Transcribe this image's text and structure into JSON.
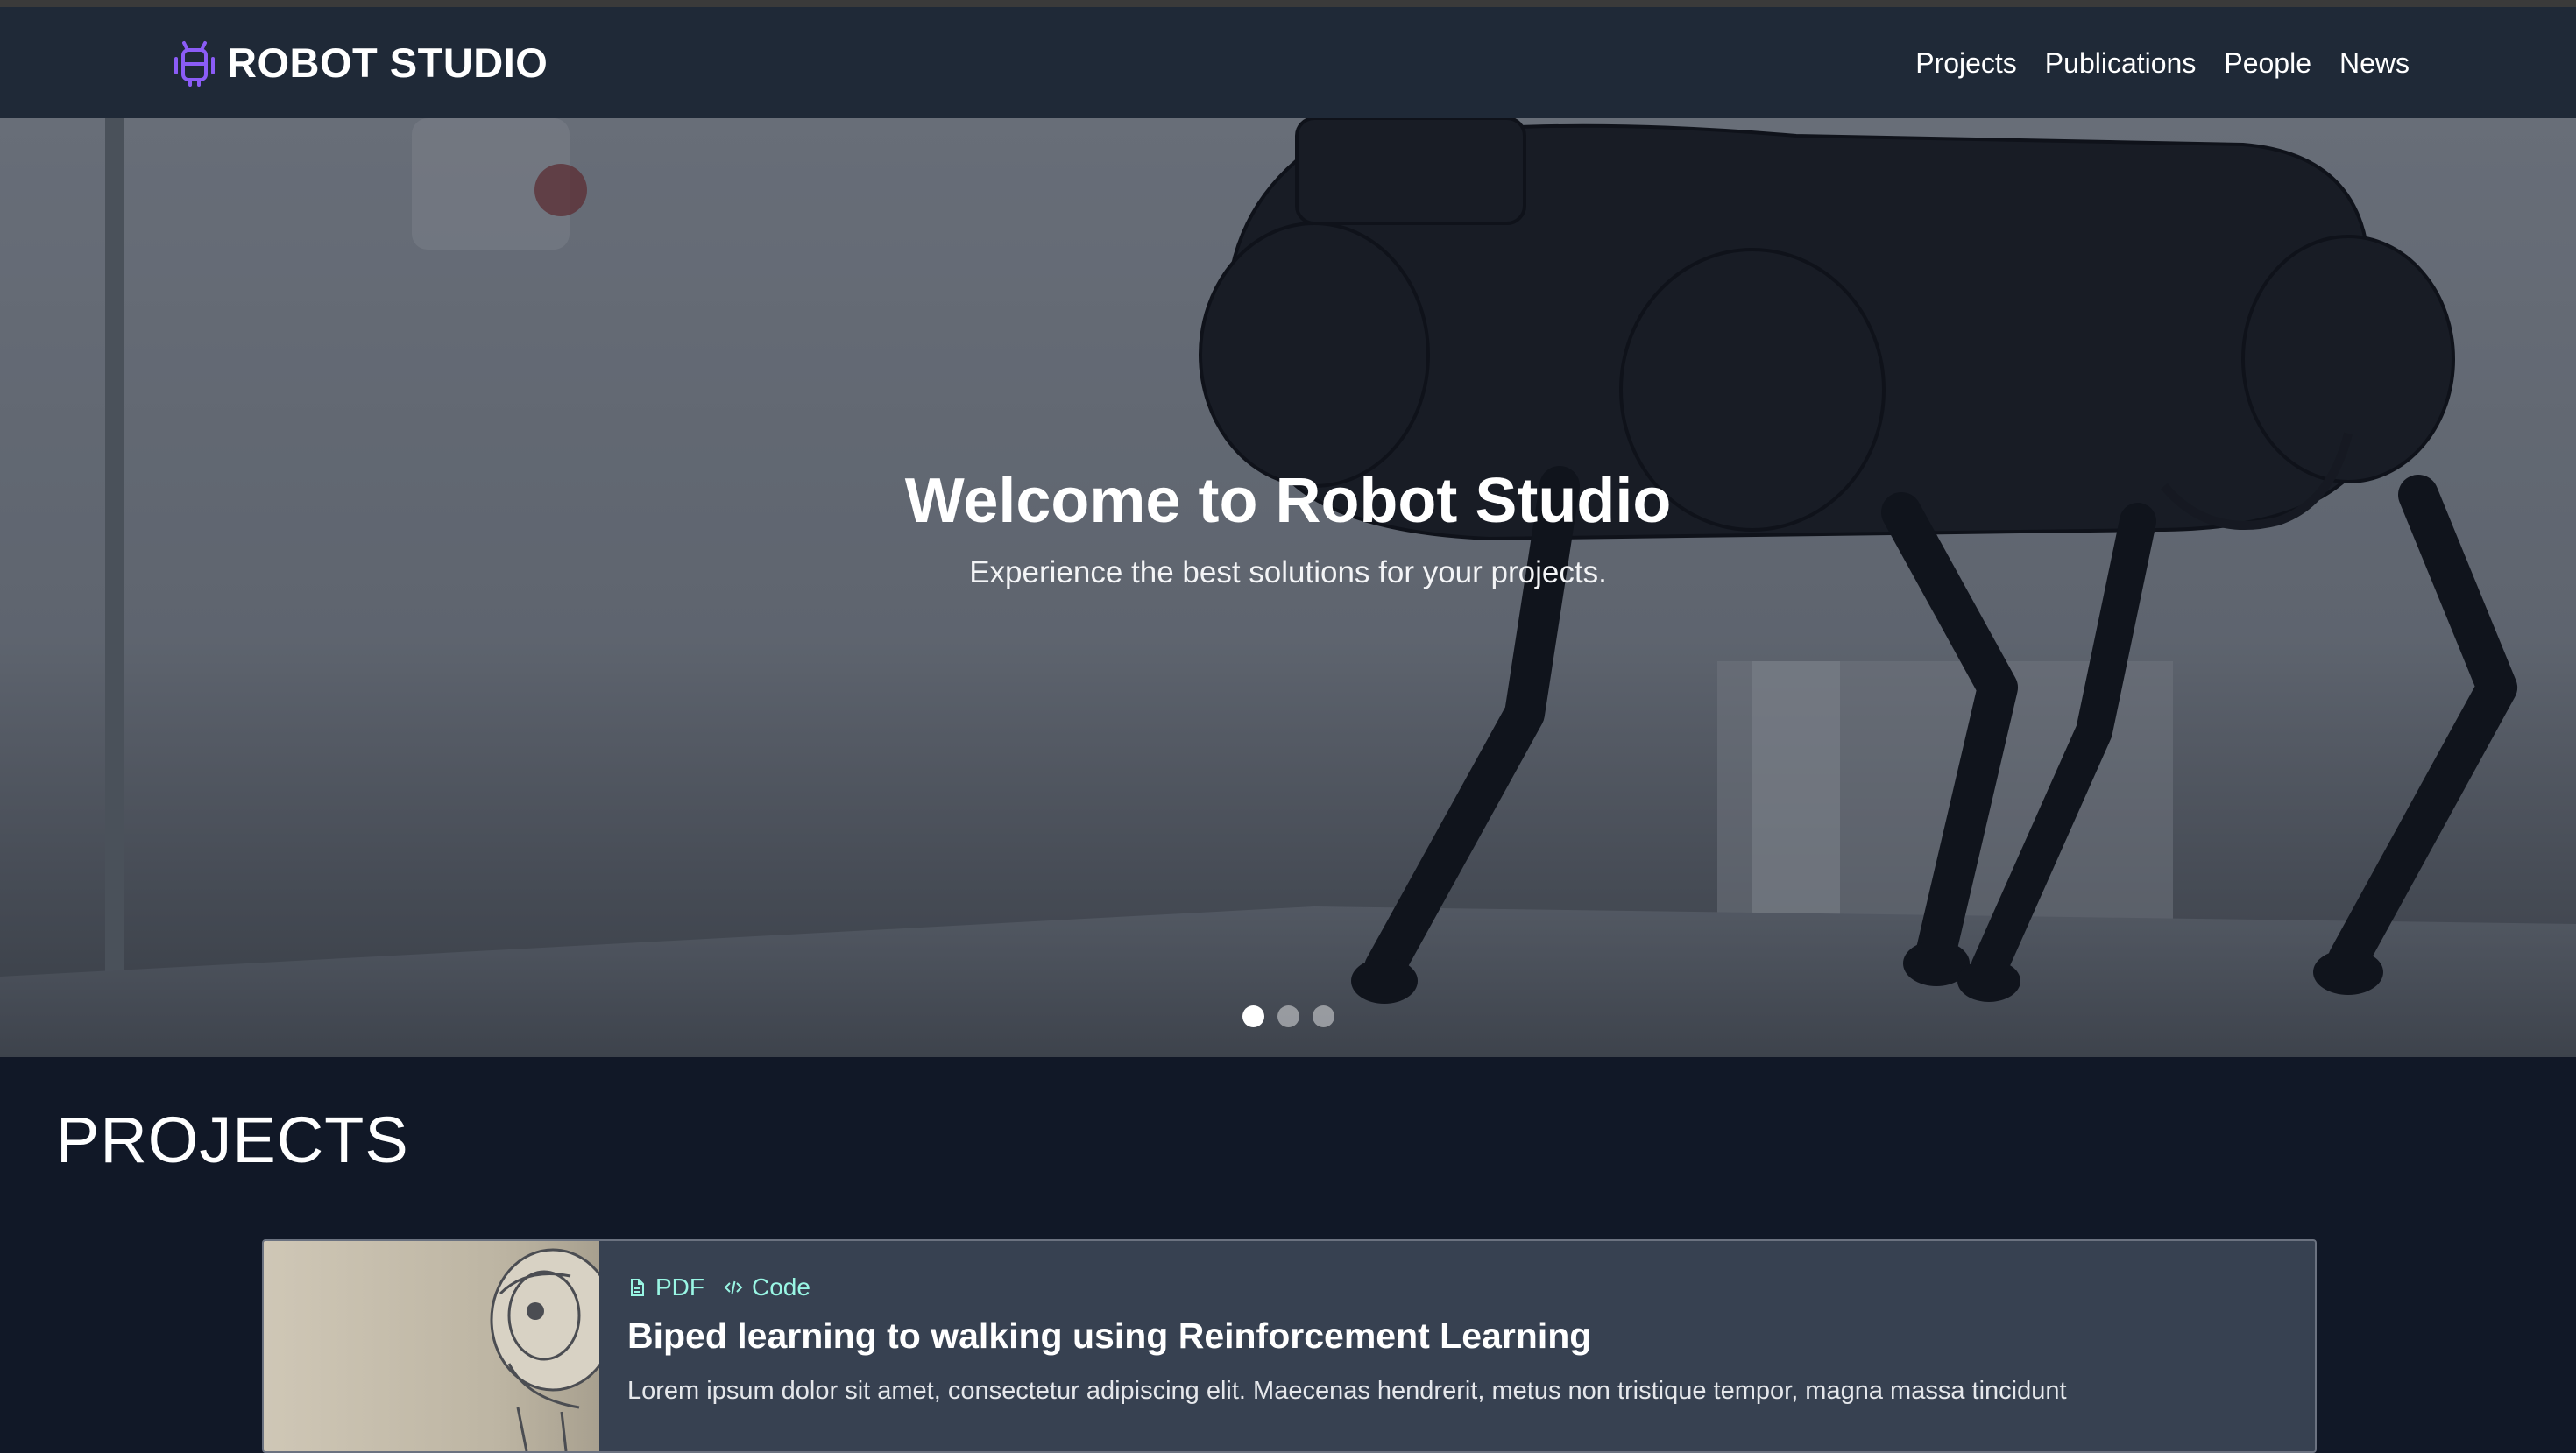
{
  "header": {
    "brand_name": "ROBOT STUDIO",
    "brand_icon": "robot-icon",
    "accent_color": "#8b5cf6",
    "nav": [
      {
        "label": "Projects"
      },
      {
        "label": "Publications"
      },
      {
        "label": "People"
      },
      {
        "label": "News"
      }
    ]
  },
  "hero": {
    "title": "Welcome to Robot Studio",
    "subtitle": "Experience the best solutions for your projects.",
    "carousel": {
      "slide_count": 3,
      "active_index": 0
    }
  },
  "projects": {
    "heading": "PROJECTS",
    "items": [
      {
        "links": [
          {
            "icon": "document-icon",
            "label": "PDF"
          },
          {
            "icon": "code-icon",
            "label": "Code"
          }
        ],
        "title": "Biped learning to walking using Reinforcement Learning",
        "description": "Lorem ipsum dolor sit amet, consectetur adipiscing elit. Maecenas hendrerit, metus non tristique tempor, magna massa tincidunt"
      }
    ]
  },
  "colors": {
    "page_bg": "#111827",
    "navbar_bg": "#1f2937",
    "card_bg": "#374151",
    "link_color": "#99f6e4"
  }
}
